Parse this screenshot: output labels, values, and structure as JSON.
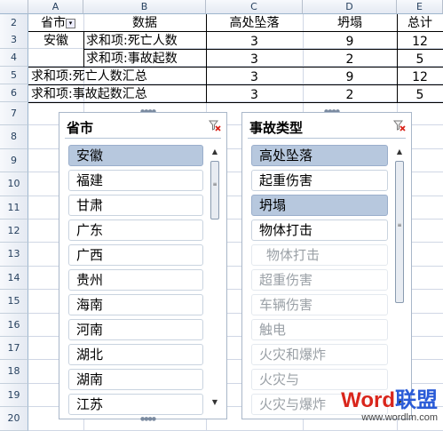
{
  "columns": [
    "A",
    "B",
    "C",
    "D",
    "E"
  ],
  "rows": [
    "2",
    "3",
    "4",
    "5",
    "6",
    "7",
    "8",
    "9",
    "10",
    "11",
    "12",
    "13",
    "14",
    "15",
    "16",
    "17",
    "18",
    "19",
    "20"
  ],
  "pivot": {
    "header_row_field": "省市",
    "header_data": "数据",
    "header_c": "高处坠落",
    "header_d": "坍塌",
    "header_e": "总计",
    "province": "安徽",
    "rows": [
      {
        "label": "求和项:死亡人数",
        "c": "3",
        "d": "9",
        "e": "12"
      },
      {
        "label": "求和项:事故起数",
        "c": "3",
        "d": "2",
        "e": "5"
      }
    ],
    "totals": [
      {
        "label": "求和项:死亡人数汇总",
        "c": "3",
        "d": "9",
        "e": "12"
      },
      {
        "label": "求和项:事故起数汇总",
        "c": "3",
        "d": "2",
        "e": "5"
      }
    ]
  },
  "slicer_province": {
    "title": "省市",
    "items": [
      {
        "label": "安徽",
        "state": "selected"
      },
      {
        "label": "福建",
        "state": "normal"
      },
      {
        "label": "甘肃",
        "state": "normal"
      },
      {
        "label": "广东",
        "state": "normal"
      },
      {
        "label": "广西",
        "state": "normal"
      },
      {
        "label": "贵州",
        "state": "normal"
      },
      {
        "label": "海南",
        "state": "normal"
      },
      {
        "label": "河南",
        "state": "normal"
      },
      {
        "label": "湖北",
        "state": "normal"
      },
      {
        "label": "湖南",
        "state": "normal"
      },
      {
        "label": "江苏",
        "state": "normal"
      }
    ]
  },
  "slicer_type": {
    "title": "事故类型",
    "items": [
      {
        "label": "高处坠落",
        "state": "selected"
      },
      {
        "label": "起重伤害",
        "state": "normal"
      },
      {
        "label": "坍塌",
        "state": "selected"
      },
      {
        "label": "物体打击",
        "state": "normal"
      },
      {
        "label": "物体打击",
        "state": "dim"
      },
      {
        "label": "超重伤害",
        "state": "dim"
      },
      {
        "label": "车辆伤害",
        "state": "dim"
      },
      {
        "label": "触电",
        "state": "dim"
      },
      {
        "label": "火灾和爆炸",
        "state": "dim"
      },
      {
        "label": "火灾与",
        "state": "dim"
      },
      {
        "label": "火灾与爆炸",
        "state": "dim"
      }
    ]
  },
  "watermark": {
    "brand_a": "Word",
    "brand_b": "联盟",
    "url": "www.wordlm.com"
  },
  "colors": {
    "selected": "#b7c8de",
    "brand_red": "#d9261c",
    "brand_blue": "#2a5bd7"
  }
}
